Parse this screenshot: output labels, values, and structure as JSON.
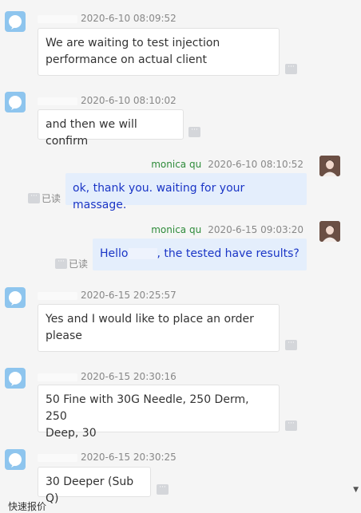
{
  "messages": [
    {
      "type": "in",
      "time": "2020-6-10 08:09:52",
      "lines": [
        "We are waiting to test injection",
        "performance on actual client"
      ]
    },
    {
      "type": "in",
      "time": "2020-6-10 08:10:02",
      "lines": [
        "and then we will confirm"
      ]
    },
    {
      "type": "out",
      "sender": "monica qu",
      "time": "2020-6-10 08:10:52",
      "text": "ok, thank you. waiting for your massage.",
      "status": "已读"
    },
    {
      "type": "out",
      "sender": "monica qu",
      "time": "2020-6-15 09:03:20",
      "text_before": "Hello",
      "text_after": ", the tested have results?",
      "status": "已读"
    },
    {
      "type": "in",
      "time": "2020-6-15 20:25:57",
      "lines": [
        "Yes and I would like to place an order",
        "please"
      ]
    },
    {
      "type": "in",
      "time": "2020-6-15 20:30:16",
      "lines": [
        "50 Fine with 30G Needle, 250 Derm, 250",
        "Deep, 30"
      ]
    },
    {
      "type": "in",
      "time": "2020-6-15 20:30:25",
      "lines": [
        "30 Deeper (Sub Q)"
      ]
    }
  ],
  "more_icon": "···",
  "bottom_label": "快速报价",
  "scroll_arrow": "▼",
  "colors": {
    "background": "#f5f5f5",
    "incoming_bubble": "#ffffff",
    "outgoing_bubble": "#e4eefc",
    "outgoing_text": "#1a35c6",
    "sender_name": "#2e8b3a",
    "avatar": "#8ec5ee"
  }
}
